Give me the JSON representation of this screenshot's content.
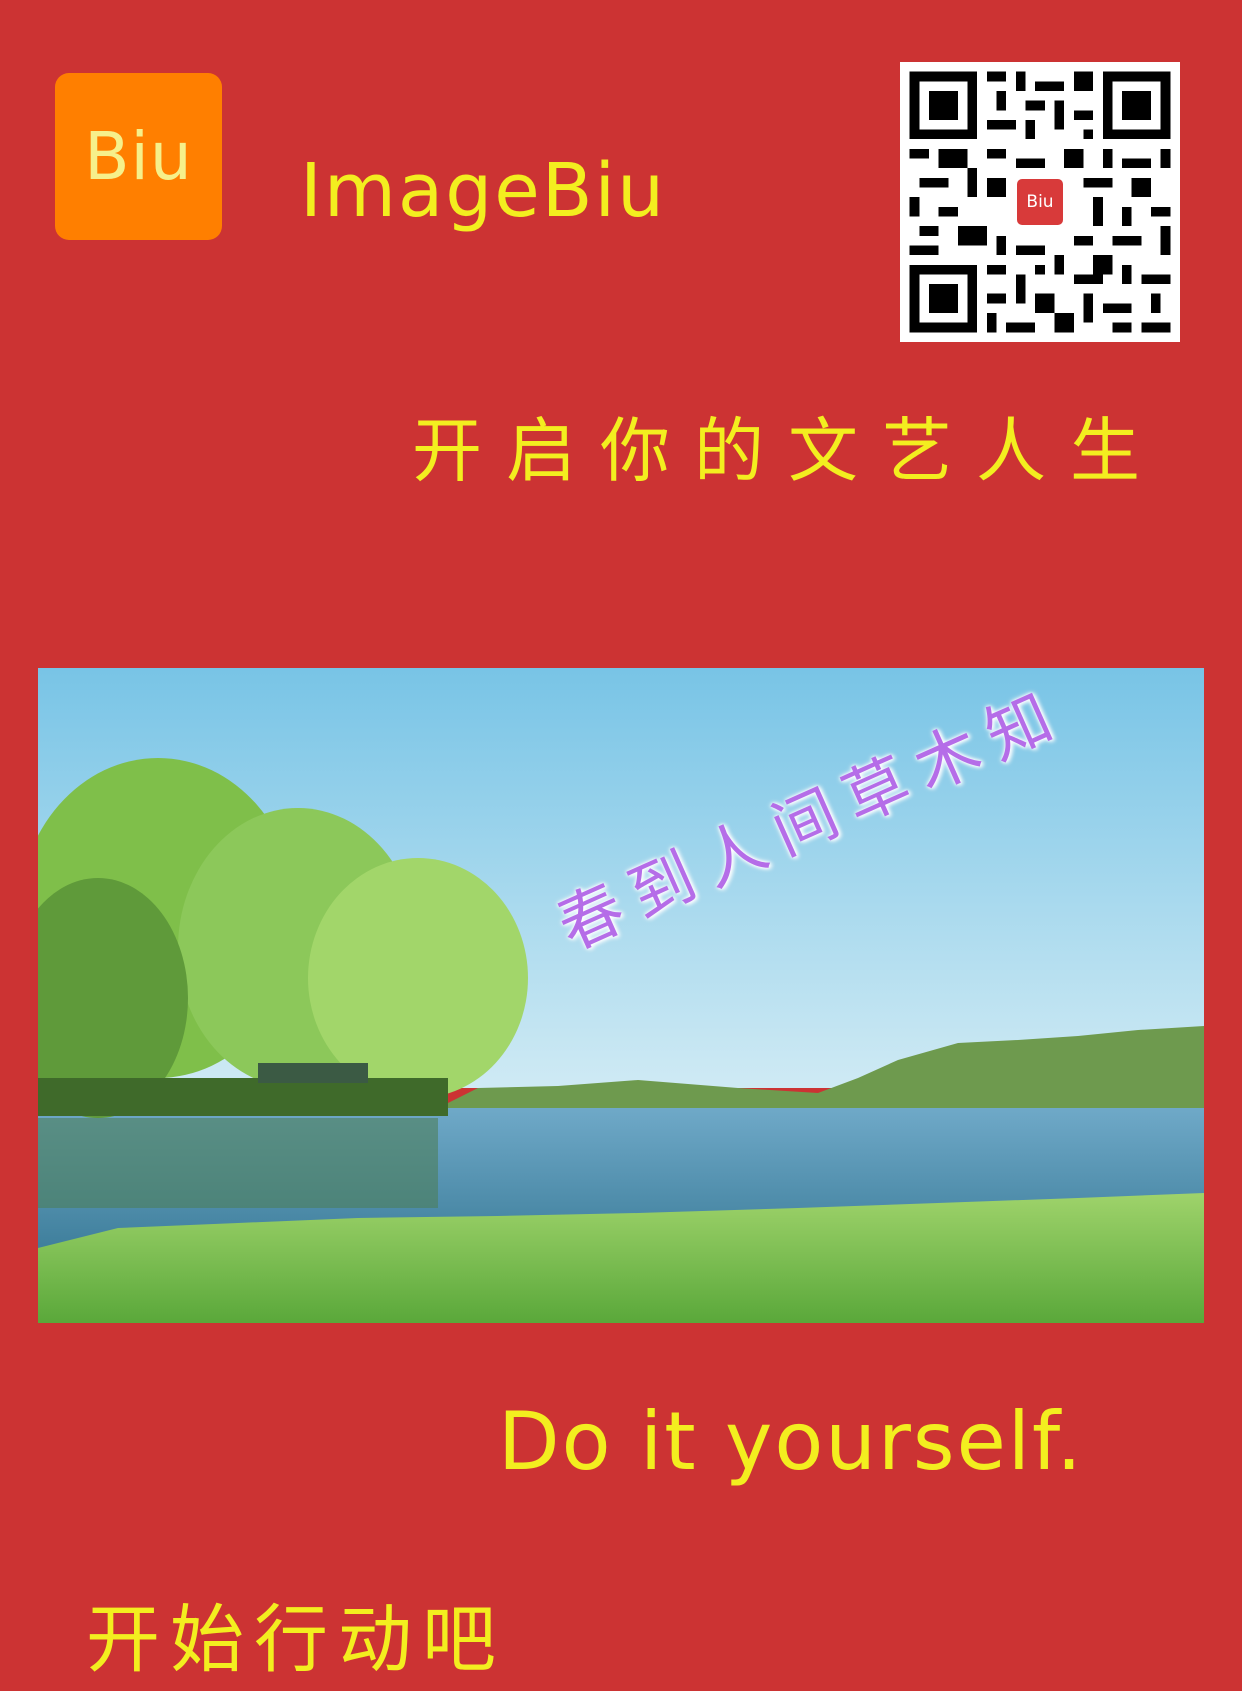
{
  "logo": {
    "text": "Biu"
  },
  "brand": {
    "name": "ImageBiu"
  },
  "qr": {
    "center_text": "Biu"
  },
  "slogan": "开启你的文艺人生",
  "photo": {
    "overlay_text": "春到人间草木知"
  },
  "tagline": "Do it yourself.",
  "cta": "开始行动吧",
  "colors": {
    "background": "#cc3333",
    "text": "#f3ee1f",
    "logo_bg": "#ff7f00",
    "overlay": "#b56de8"
  }
}
